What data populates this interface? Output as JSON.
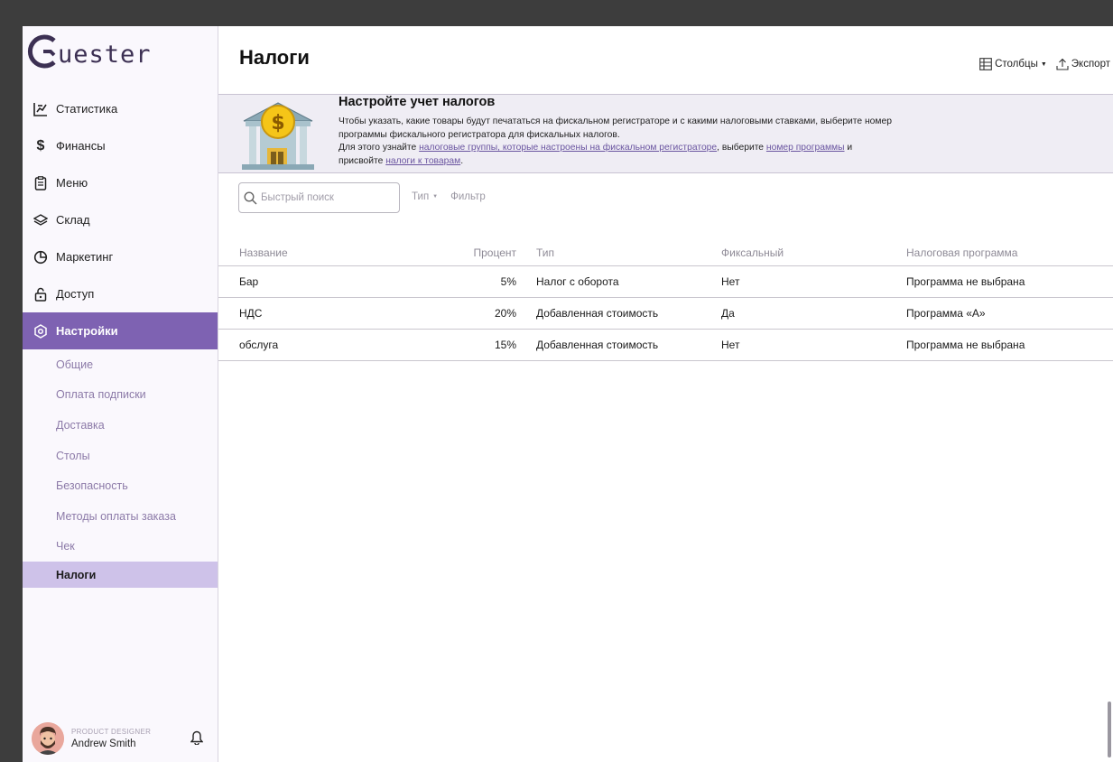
{
  "app": {
    "logo_text": "uester"
  },
  "sidebar": {
    "items": [
      {
        "label": "Статистика",
        "icon": "chart-icon"
      },
      {
        "label": "Финансы",
        "icon": "dollar-icon"
      },
      {
        "label": "Меню",
        "icon": "clipboard-icon"
      },
      {
        "label": "Склад",
        "icon": "layers-icon"
      },
      {
        "label": "Маркетинг",
        "icon": "pie-icon"
      },
      {
        "label": "Доступ",
        "icon": "lock-icon"
      },
      {
        "label": "Настройки",
        "icon": "settings-icon",
        "active": true
      }
    ],
    "sub_items": [
      {
        "label": "Общие"
      },
      {
        "label": "Оплата подписки"
      },
      {
        "label": "Доставка"
      },
      {
        "label": "Столы"
      },
      {
        "label": "Безопасность"
      },
      {
        "label": "Методы оплаты заказа"
      },
      {
        "label": "Чек"
      },
      {
        "label": "Налоги",
        "active": true
      }
    ],
    "user": {
      "role": "PRODUCT DESIGNER",
      "name": "Andrew Smith"
    }
  },
  "header": {
    "title": "Налоги",
    "columns_label": "Столбцы",
    "export_label": "Экспорт"
  },
  "banner": {
    "title": "Настройте учет налогов",
    "line1": "Чтобы указать, какие товары будут печататься на фискальном регистраторе и с какими налоговыми ставками, выберите номер программы фискального регистратора для фискальных налогов.",
    "line2_prefix": "Для этого узнайте ",
    "link1": "налоговые группы, которые настроены на фискальном регистраторе",
    "line2_mid": ", выберите ",
    "link2": "номер программы",
    "line2_mid2": " и присвойте ",
    "link3": "налоги к товарам",
    "line2_end": "."
  },
  "toolbar": {
    "search_placeholder": "Быстрый поиск",
    "type_label": "Тип",
    "filter_label": "Фильтр"
  },
  "table": {
    "headers": [
      "Название",
      "Процент",
      "Тип",
      "Фиксальный",
      "Налоговая программа"
    ],
    "rows": [
      [
        "Бар",
        "5%",
        "Налог с оборота",
        "Нет",
        "Программа не выбрана"
      ],
      [
        "НДС",
        "20%",
        "Добавленная стоимость",
        "Да",
        "Программа «А»"
      ],
      [
        "обслуга",
        "15%",
        "Добавленная стоимость",
        "Нет",
        "Программа не выбрана"
      ]
    ]
  },
  "colors": {
    "accent": "#7e62b2",
    "accent_light": "#cec2e9",
    "banner_bg": "#efedf4"
  }
}
